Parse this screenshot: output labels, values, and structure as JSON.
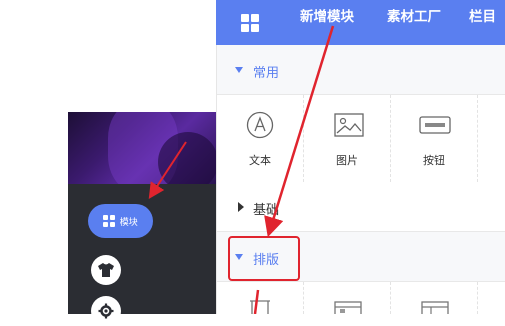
{
  "sidebar": {
    "module_button": {
      "label": "模块",
      "icon": "grid-icon"
    },
    "shirt_button": {
      "icon": "tshirt-icon"
    },
    "settings_button": {
      "icon": "gear-icon"
    }
  },
  "topbar": {
    "home_icon": "grid-icon",
    "tabs": [
      {
        "label": "新增模块"
      },
      {
        "label": "素材工厂"
      },
      {
        "label": "栏目"
      }
    ]
  },
  "sections": {
    "common": {
      "title": "常用",
      "items": [
        {
          "label": "文本",
          "icon": "text-icon"
        },
        {
          "label": "图片",
          "icon": "image-icon"
        },
        {
          "label": "按钮",
          "icon": "button-icon"
        }
      ]
    },
    "basic": {
      "title": "基础"
    },
    "layout": {
      "title": "排版"
    }
  },
  "colors": {
    "accent": "#5a7ff0",
    "highlight": "#e0242e",
    "sidebar_bg": "#2b2d33"
  }
}
